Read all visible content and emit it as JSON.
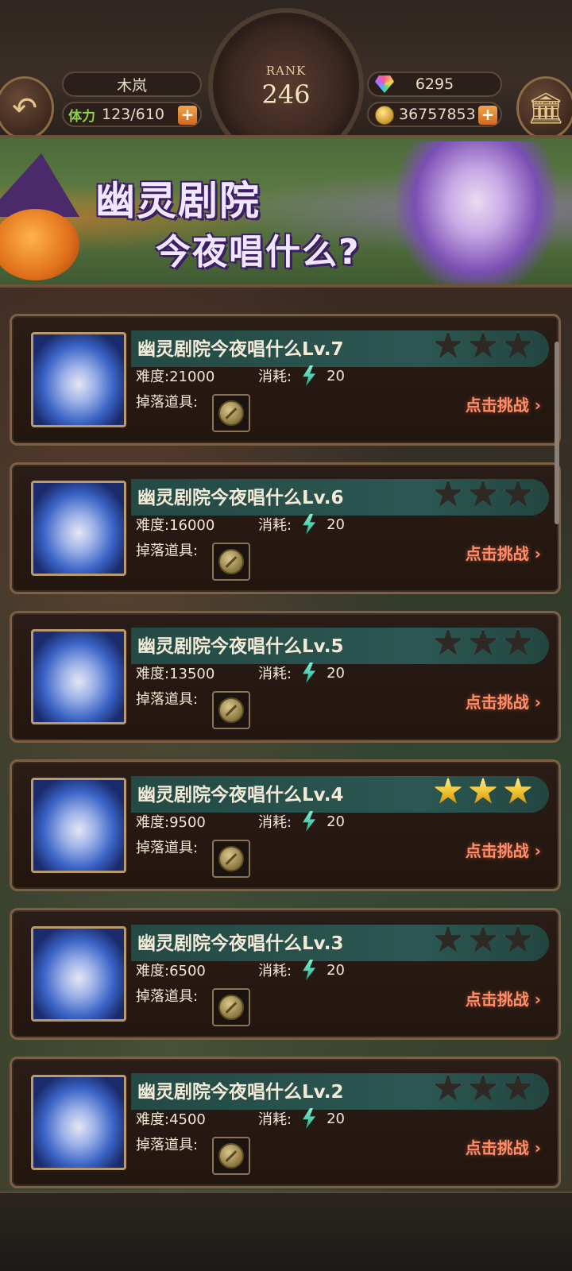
{
  "header": {
    "player_name": "木岚",
    "stamina_label": "体力",
    "stamina_value": "123/610",
    "rank_label": "RANK",
    "rank_value": "246",
    "gems": "6295",
    "gold": "36757853",
    "plus_symbol": "+",
    "back_icon": "back-arrow-icon",
    "bank_icon": "bank-building-icon"
  },
  "banner": {
    "title_line1": "幽灵剧院",
    "title_line2": "今夜唱什么?"
  },
  "labels": {
    "difficulty": "难度:",
    "cost": "消耗:",
    "drops": "掉落道具:",
    "challenge": "点击挑战 ›"
  },
  "levels": [
    {
      "name": "幽灵剧院今夜唱什么Lv.7",
      "difficulty": "21000",
      "cost": "20",
      "stars": 0
    },
    {
      "name": "幽灵剧院今夜唱什么Lv.6",
      "difficulty": "16000",
      "cost": "20",
      "stars": 0
    },
    {
      "name": "幽灵剧院今夜唱什么Lv.5",
      "difficulty": "13500",
      "cost": "20",
      "stars": 0
    },
    {
      "name": "幽灵剧院今夜唱什么Lv.4",
      "difficulty": "9500",
      "cost": "20",
      "stars": 3
    },
    {
      "name": "幽灵剧院今夜唱什么Lv.3",
      "difficulty": "6500",
      "cost": "20",
      "stars": 0
    },
    {
      "name": "幽灵剧院今夜唱什么Lv.2",
      "difficulty": "4500",
      "cost": "20",
      "stars": 0
    }
  ],
  "colors": {
    "accent_challenge": "#ff8d6a",
    "star_lit": "#f2c431",
    "name_bar": "#2c5752"
  }
}
